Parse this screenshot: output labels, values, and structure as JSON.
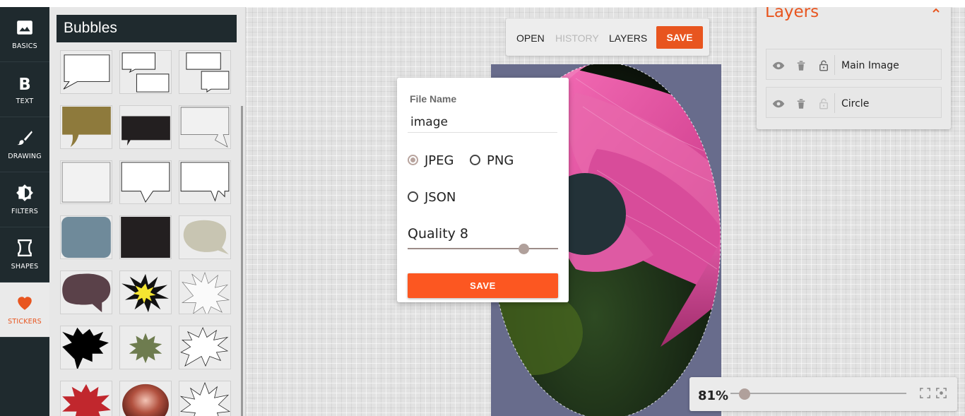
{
  "sidebar": {
    "items": [
      {
        "label": "BASICS",
        "icon": "image-icon"
      },
      {
        "label": "TEXT",
        "icon": "bold-icon"
      },
      {
        "label": "DRAWING",
        "icon": "brush-icon"
      },
      {
        "label": "FILTERS",
        "icon": "brightness-icon"
      },
      {
        "label": "SHAPES",
        "icon": "shapes-icon"
      },
      {
        "label": "STICKERS",
        "icon": "heart-icon",
        "active": true
      }
    ]
  },
  "stickers_panel": {
    "title": "Bubbles"
  },
  "toolbar": {
    "open_label": "OPEN",
    "history_label": "HISTORY",
    "layers_label": "LAYERS",
    "save_label": "SAVE"
  },
  "save_dialog": {
    "file_name_label": "File Name",
    "file_name_value": "image",
    "formats": [
      {
        "label": "JPEG",
        "selected": true
      },
      {
        "label": "PNG",
        "selected": false
      },
      {
        "label": "JSON",
        "selected": false
      }
    ],
    "quality_label": "Quality 8",
    "quality_value": 8,
    "save_label": "SAVE"
  },
  "layers_panel": {
    "title": "Layers",
    "layers": [
      {
        "name": "Main Image",
        "locked_icon": "unlock-icon"
      },
      {
        "name": "Circle",
        "locked_icon": "unlock-icon"
      }
    ]
  },
  "zoom": {
    "value_label": "81%",
    "value": 81
  },
  "colors": {
    "accent": "#e8551f",
    "sidebar_bg": "#1f2a2e",
    "dialog_button": "#fc5721"
  }
}
